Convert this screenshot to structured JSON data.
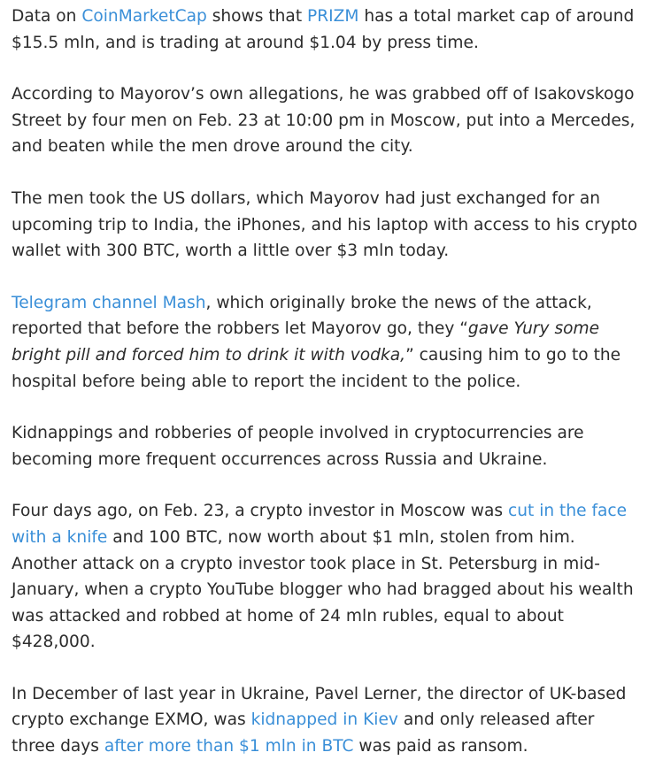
{
  "article": {
    "p1": {
      "t1": "Data on ",
      "link1": "CoinMarketCap",
      "t2": " shows that ",
      "link2": "PRIZM",
      "t3": " has a total market cap of around $15.5 mln, and is trading at around $1.04 by press time."
    },
    "p2": {
      "text": "According to Mayorov’s own allegations, he was grabbed off of Isakovskogo Street by four men on Feb. 23 at 10:00 pm in Moscow, put into a Mercedes, and beaten while the men drove around the city."
    },
    "p3": {
      "text": "The men took the US dollars, which Mayorov had just exchanged for an upcoming trip to India, the iPhones, and his laptop with access to his crypto wallet with 300 BTC, worth a little over $3 mln today."
    },
    "p4": {
      "link1": "Telegram channel Mash",
      "t1": ", which originally broke the news of the attack, reported that before the robbers let Mayorov go, they “",
      "quote": "gave Yury some bright pill and forced him to drink it with vodka,",
      "t2": "” causing him to go to the hospital before being able to report the incident to the police."
    },
    "p5": {
      "text": "Kidnappings and robberies of people involved in cryptocurrencies are becoming more frequent occurrences across Russia and Ukraine."
    },
    "p6": {
      "t1": "Four days ago, on Feb. 23, a crypto investor in Moscow was ",
      "link1": "cut in the face with a knife",
      "t2": " and 100 BTC, now worth about $1 mln, stolen from him. Another attack on a crypto investor took place in St. Petersburg in mid-January, when a crypto YouTube blogger who had bragged about his wealth was attacked and robbed at home of 24 mln rubles, equal to about $428,000."
    },
    "p7": {
      "t1": "In December of last year in Ukraine, Pavel Lerner, the director of UK-based crypto exchange EXMO, was ",
      "link1": "kidnapped in Kiev",
      "t2": " and only released after three days ",
      "link2": "after more than $1 mln in BTC",
      "t3": " was paid as ransom."
    }
  },
  "colors": {
    "text": "#2b2b2b",
    "link": "#3a8fd8",
    "background": "#ffffff"
  }
}
